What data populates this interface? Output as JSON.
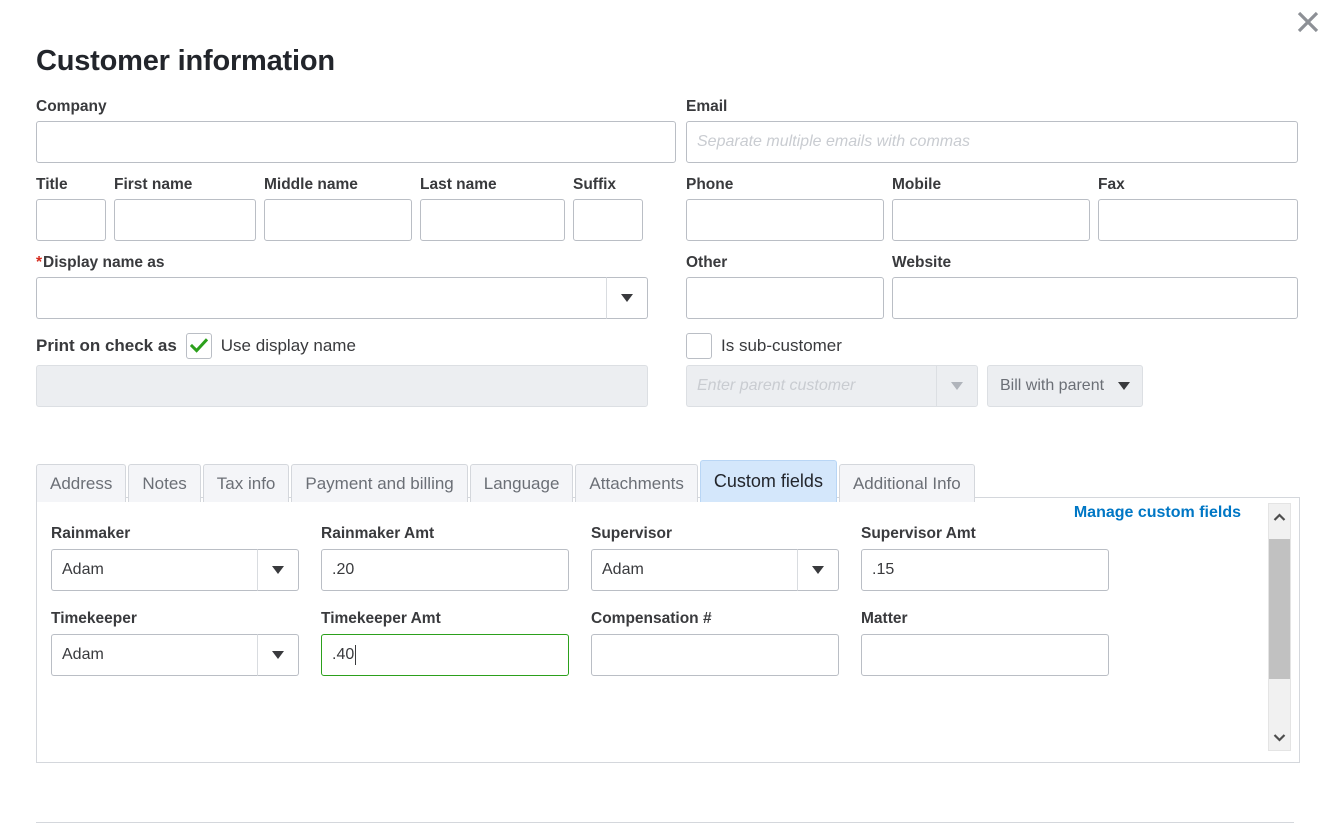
{
  "modal": {
    "title": "Customer information",
    "close_icon": "close-icon"
  },
  "form": {
    "left": {
      "company_label": "Company",
      "company_value": "",
      "title_label": "Title",
      "title_value": "",
      "first_name_label": "First name",
      "first_name_value": "",
      "middle_name_label": "Middle name",
      "middle_name_value": "",
      "last_name_label": "Last name",
      "last_name_value": "",
      "suffix_label": "Suffix",
      "suffix_value": "",
      "display_name_required_marker": "*",
      "display_name_label": "Display name as",
      "display_name_value": "",
      "print_on_check_label": "Print on check as",
      "use_display_name_label": "Use display name",
      "use_display_name_checked": true,
      "print_on_check_value": ""
    },
    "right": {
      "email_label": "Email",
      "email_value": "",
      "email_placeholder": "Separate multiple emails with commas",
      "phone_label": "Phone",
      "phone_value": "",
      "mobile_label": "Mobile",
      "mobile_value": "",
      "fax_label": "Fax",
      "fax_value": "",
      "other_label": "Other",
      "other_value": "",
      "website_label": "Website",
      "website_value": "",
      "is_sub_customer_label": "Is sub-customer",
      "is_sub_customer_checked": false,
      "parent_customer_value": "",
      "parent_customer_placeholder": "Enter parent customer",
      "billing_option": "Bill with parent"
    }
  },
  "tabs": [
    {
      "label": "Address",
      "active": false
    },
    {
      "label": "Notes",
      "active": false
    },
    {
      "label": "Tax info",
      "active": false
    },
    {
      "label": "Payment and billing",
      "active": false
    },
    {
      "label": "Language",
      "active": false
    },
    {
      "label": "Attachments",
      "active": false
    },
    {
      "label": "Custom fields",
      "active": true
    },
    {
      "label": "Additional Info",
      "active": false
    }
  ],
  "custom_fields": {
    "manage_link": "Manage custom fields",
    "rows": [
      [
        {
          "label": "Rainmaker",
          "value": "Adam",
          "type": "dropdown",
          "focused": false
        },
        {
          "label": "Rainmaker Amt",
          "value": ".20",
          "type": "text",
          "focused": false
        },
        {
          "label": "Supervisor",
          "value": "Adam",
          "type": "dropdown",
          "focused": false
        },
        {
          "label": "Supervisor Amt",
          "value": ".15",
          "type": "text",
          "focused": false
        }
      ],
      [
        {
          "label": "Timekeeper",
          "value": "Adam",
          "type": "dropdown",
          "focused": false
        },
        {
          "label": "Timekeeper Amt",
          "value": ".40",
          "type": "text",
          "focused": true
        },
        {
          "label": "Compensation #",
          "value": "",
          "type": "text",
          "focused": false
        },
        {
          "label": "Matter",
          "value": "",
          "type": "text",
          "focused": false
        }
      ]
    ]
  },
  "colors": {
    "accent_link": "#0077c5",
    "active_tab_bg": "#d4e7fb",
    "focus_green": "#2ca01c",
    "required_red": "#d52b1e",
    "checkmark_green": "#2ca01c"
  }
}
